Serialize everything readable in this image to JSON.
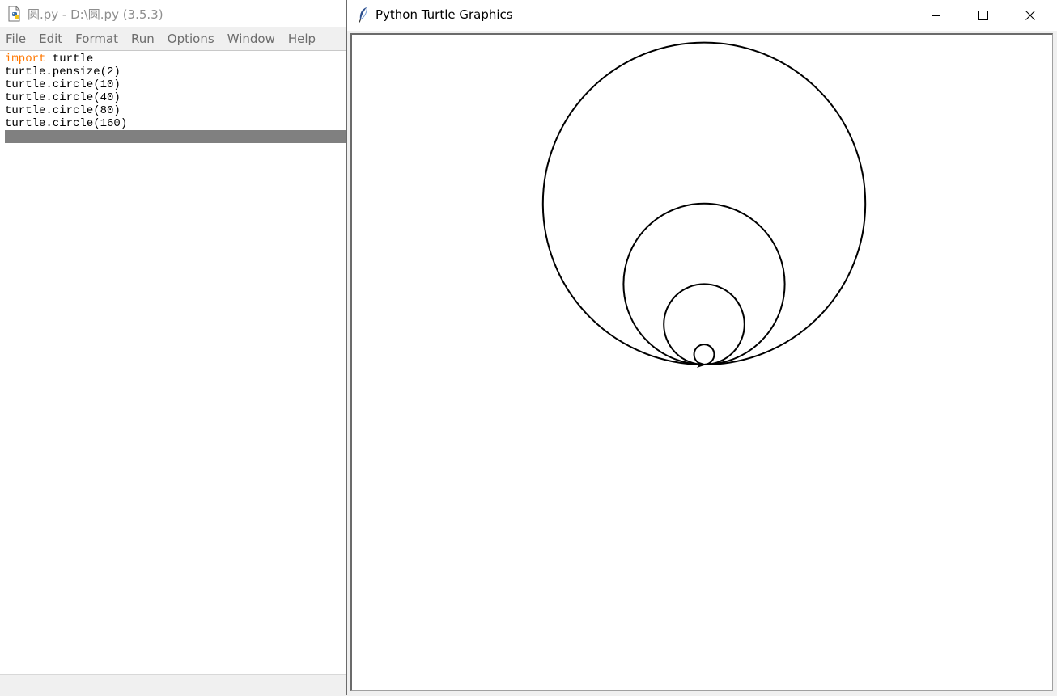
{
  "idle": {
    "title": "圆.py - D:\\圆.py (3.5.3)",
    "menu": [
      "File",
      "Edit",
      "Format",
      "Run",
      "Options",
      "Window",
      "Help"
    ],
    "code": [
      {
        "kw": "import",
        "rest": " turtle"
      },
      {
        "kw": "",
        "rest": "turtle.pensize(2)"
      },
      {
        "kw": "",
        "rest": "turtle.circle(10)"
      },
      {
        "kw": "",
        "rest": "turtle.circle(40)"
      },
      {
        "kw": "",
        "rest": "turtle.circle(80)"
      },
      {
        "kw": "",
        "rest": "turtle.circle(160)"
      }
    ],
    "keyword_color": "#ff7700"
  },
  "turtle_window": {
    "title": "Python Turtle Graphics",
    "pen_size": 2,
    "circle_radii": [
      10,
      40,
      80,
      160
    ],
    "pen_color": "#000000",
    "canvas_color": "#ffffff"
  },
  "icons": {
    "idle_app": "python-file-icon",
    "turtle_app": "feather-icon",
    "minimize": "minimize-icon",
    "maximize": "maximize-icon",
    "close": "close-icon"
  }
}
